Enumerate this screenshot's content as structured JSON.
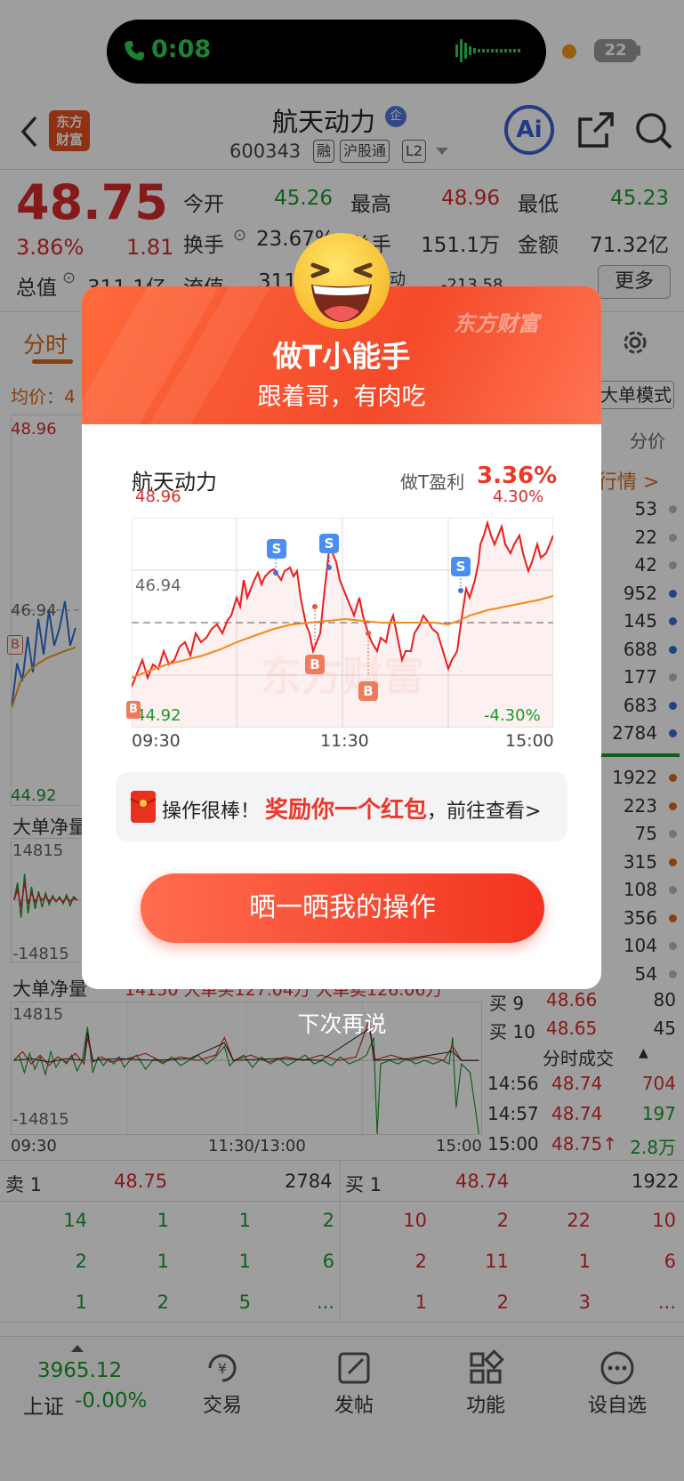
{
  "status_bar": {
    "call_time": "0:08",
    "battery": "22"
  },
  "header": {
    "stock_name": "航天动力",
    "ent_badge": "企",
    "stock_code": "600343",
    "tags": [
      "融",
      "沪股通",
      "L2"
    ],
    "logo_line1": "东方",
    "logo_line2": "财富",
    "ai_label": "Ai"
  },
  "quote": {
    "price": "48.75",
    "change_pct": "3.86%",
    "change_amt": "1.81",
    "open_label": "今开",
    "open": "45.26",
    "high_label": "最高",
    "high": "48.96",
    "low_label": "最低",
    "low": "45.23",
    "turnover_label": "换手",
    "turnover": "23.67%",
    "volume_label": "总手",
    "volume": "151.1万",
    "amount_label": "金额",
    "amount": "71.32亿",
    "mktcap_label": "总值",
    "mktcap": "311.1亿",
    "float_label": "流值",
    "float": "311",
    "extra_label": "动",
    "extra_value": "-213.58",
    "more_label": "更多"
  },
  "tabs": {
    "time_label": "分时",
    "avg_label": "均价：4",
    "big_mode": "大单模式"
  },
  "main_chart": {
    "y_max": "48.96",
    "y_mid": "46.94",
    "y_min": "44.92",
    "b_marker": "B"
  },
  "right_panel": {
    "title": "分价",
    "market_link": "行情 >",
    "sell_volumes": [
      "53",
      "22",
      "42",
      "952",
      "145",
      "688",
      "177",
      "683",
      "2784"
    ],
    "sell_dot_colors": [
      "#bbb",
      "#bbb",
      "#bbb",
      "#2f6fd9",
      "#2f6fd9",
      "#2f6fd9",
      "#bbb",
      "#2f6fd9",
      "#2f6fd9"
    ],
    "buy_volumes": [
      "1922",
      "223",
      "75",
      "315",
      "108",
      "356",
      "104",
      "54"
    ],
    "buy_dot_colors": [
      "#d96a1a",
      "#d96a1a",
      "#bbb",
      "#d96a1a",
      "#bbb",
      "#d96a1a",
      "#bbb",
      "#bbb"
    ],
    "buy_rows": [
      {
        "label": "买 9",
        "price": "48.66",
        "vol": "80"
      },
      {
        "label": "买 10",
        "price": "48.65",
        "vol": "45"
      }
    ],
    "ticks_title": "分时成交",
    "ticks": [
      {
        "time": "14:56",
        "price": "48.74",
        "vol": "704"
      },
      {
        "time": "14:57",
        "price": "48.74",
        "vol": "197"
      },
      {
        "time": "15:00",
        "price": "48.75↑",
        "vol": "2.8万"
      }
    ]
  },
  "flow": {
    "label": "大单净量",
    "legend": "14150  大单买127.04万  大单卖126.06万",
    "y_max": "14815",
    "y_min": "-14815",
    "time_start": "09:30",
    "time_mid": "11:30/13:00",
    "time_end": "15:00"
  },
  "book": {
    "sell_label": "卖 1",
    "sell_price": "48.75",
    "sell_vol": "2784",
    "buy_label": "买 1",
    "buy_price": "48.74",
    "buy_vol": "1922",
    "sell_queue": [
      [
        "14",
        "1",
        "1",
        "2"
      ],
      [
        "2",
        "1",
        "1",
        "6"
      ],
      [
        "1",
        "2",
        "5",
        "..."
      ]
    ],
    "buy_queue": [
      [
        "10",
        "2",
        "22",
        "10"
      ],
      [
        "2",
        "11",
        "1",
        "6"
      ],
      [
        "1",
        "2",
        "3",
        "..."
      ]
    ]
  },
  "bottom_nav": {
    "index_value": "3965.12",
    "index_name": "上证",
    "index_change": "-0.00%",
    "items": [
      "交易",
      "发帖",
      "功能",
      "设自选"
    ]
  },
  "popup": {
    "brand": "东方财富",
    "title": "做T小能手",
    "subtitle": "跟着哥，有肉吃",
    "stock": "航天动力",
    "profit_label": "做T盈利",
    "profit_value": "3.36%",
    "chart": {
      "y_max": "48.96",
      "y_mid": "46.94",
      "y_min": "44.92",
      "pct_max": "4.30%",
      "pct_min": "-4.30%",
      "time_start": "09:30",
      "time_mid": "11:30",
      "time_end": "15:00",
      "sell_marker": "S",
      "buy_marker": "B"
    },
    "rp_text1": "操作很棒！",
    "rp_text2": "奖励你一个红包",
    "rp_text3": "，前往查看>",
    "share_button": "晒一晒我的操作",
    "dismiss": "下次再说"
  }
}
